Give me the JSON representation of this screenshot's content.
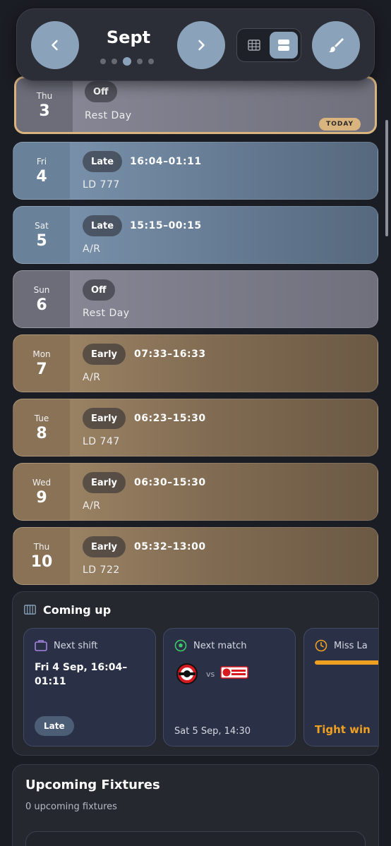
{
  "header": {
    "month": "Sept",
    "pages": 5,
    "active_page": 2,
    "icons": {
      "prev": "chevron-left-icon",
      "next": "chevron-right-icon",
      "grid": "grid-view-icon",
      "list": "list-view-icon",
      "brush": "paint-brush-icon"
    }
  },
  "today_label": "TODAY",
  "days": [
    {
      "weekday": "Thu",
      "day": "3",
      "type": "Off",
      "time": "",
      "note": "Rest Day",
      "today": true
    },
    {
      "weekday": "Fri",
      "day": "4",
      "type": "Late",
      "time": "16:04–01:11",
      "note": "LD  777"
    },
    {
      "weekday": "Sat",
      "day": "5",
      "type": "Late",
      "time": "15:15–00:15",
      "note": "A/R"
    },
    {
      "weekday": "Sun",
      "day": "6",
      "type": "Off",
      "time": "",
      "note": "Rest Day"
    },
    {
      "weekday": "Mon",
      "day": "7",
      "type": "Early",
      "time": "07:33–16:33",
      "note": "A/R"
    },
    {
      "weekday": "Tue",
      "day": "8",
      "type": "Early",
      "time": "06:23–15:30",
      "note": "LD  747"
    },
    {
      "weekday": "Wed",
      "day": "9",
      "type": "Early",
      "time": "06:30–15:30",
      "note": "A/R"
    },
    {
      "weekday": "Thu",
      "day": "10",
      "type": "Early",
      "time": "05:32–13:00",
      "note": "LD  722"
    }
  ],
  "coming_up": {
    "title": "Coming up",
    "next_shift": {
      "title": "Next shift",
      "date": "Fri 4 Sep, 16:04–01:11",
      "badge": "Late"
    },
    "next_match": {
      "title": "Next match",
      "vs": "vs",
      "date": "Sat 5 Sep, 14:30"
    },
    "miss": {
      "title": "Miss La",
      "text": "Tight win",
      "bar_fraction": 1.0
    }
  },
  "fixtures": {
    "title": "Upcoming Fixtures",
    "subtitle": "0 upcoming fixtures"
  },
  "colors": {
    "accent_blue": "#8aa3bb",
    "today_gold": "#d9b47f",
    "warning_orange": "#f0a020",
    "off_grey": "#8a8a98",
    "late_blue": "#7e97b1",
    "early_brown": "#a48a6a"
  }
}
